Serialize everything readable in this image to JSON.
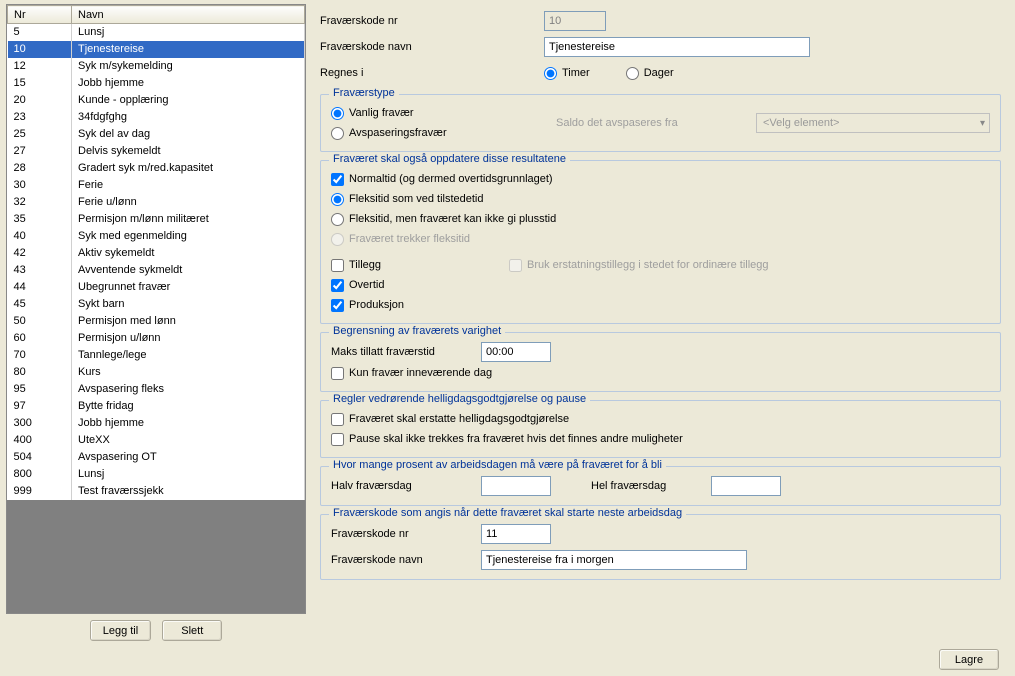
{
  "grid": {
    "headers": {
      "nr": "Nr",
      "navn": "Navn"
    },
    "rows": [
      {
        "nr": "5",
        "navn": "Lunsj"
      },
      {
        "nr": "10",
        "navn": "Tjenestereise",
        "selected": true
      },
      {
        "nr": "12",
        "navn": "Syk m/sykemelding"
      },
      {
        "nr": "15",
        "navn": "Jobb hjemme"
      },
      {
        "nr": "20",
        "navn": "Kunde - opplæring"
      },
      {
        "nr": "23",
        "navn": "34fdgfghg"
      },
      {
        "nr": "25",
        "navn": "Syk del av dag"
      },
      {
        "nr": "27",
        "navn": "Delvis sykemeldt"
      },
      {
        "nr": "28",
        "navn": "Gradert syk m/red.kapasitet"
      },
      {
        "nr": "30",
        "navn": "Ferie"
      },
      {
        "nr": "32",
        "navn": "Ferie u/lønn"
      },
      {
        "nr": "35",
        "navn": "Permisjon m/lønn militæret"
      },
      {
        "nr": "40",
        "navn": "Syk med egenmelding"
      },
      {
        "nr": "42",
        "navn": "Aktiv sykemeldt"
      },
      {
        "nr": "43",
        "navn": "Avventende sykmeldt"
      },
      {
        "nr": "44",
        "navn": "Ubegrunnet fravær"
      },
      {
        "nr": "45",
        "navn": "Sykt barn"
      },
      {
        "nr": "50",
        "navn": "Permisjon med lønn"
      },
      {
        "nr": "60",
        "navn": "Permisjon u/lønn"
      },
      {
        "nr": "70",
        "navn": "Tannlege/lege"
      },
      {
        "nr": "80",
        "navn": "Kurs"
      },
      {
        "nr": "95",
        "navn": "Avspasering fleks"
      },
      {
        "nr": "97",
        "navn": "Bytte fridag"
      },
      {
        "nr": "300",
        "navn": "Jobb hjemme"
      },
      {
        "nr": "400",
        "navn": "UteXX"
      },
      {
        "nr": "504",
        "navn": "Avspasering OT"
      },
      {
        "nr": "800",
        "navn": "Lunsj"
      },
      {
        "nr": "999",
        "navn": "Test fraværssjekk"
      }
    ]
  },
  "buttons": {
    "add": "Legg til",
    "delete": "Slett",
    "save": "Lagre"
  },
  "form": {
    "kode_nr_label": "Fraværskode nr",
    "kode_nr_value": "10",
    "kode_navn_label": "Fraværskode navn",
    "kode_navn_value": "Tjenestereise",
    "regnes_label": "Regnes i",
    "regnes_timer": "Timer",
    "regnes_dager": "Dager"
  },
  "type": {
    "legend": "Fraværstype",
    "vanlig": "Vanlig fravær",
    "avsp": "Avspaseringsfravær",
    "saldo_label": "Saldo det avspaseres fra",
    "saldo_placeholder": "<Velg element>"
  },
  "oppdater": {
    "legend": "Fraværet skal også oppdatere disse resultatene",
    "normaltid": "Normaltid (og dermed overtidsgrunnlaget)",
    "flex_tilstede": "Fleksitid som ved tilstedetid",
    "flex_ikkepluss": "Fleksitid, men fraværet kan ikke gi plusstid",
    "flex_trekker": "Fraværet trekker fleksitid",
    "tillegg": "Tillegg",
    "erstatning": "Bruk erstatningstillegg i stedet for ordinære tillegg",
    "overtid": "Overtid",
    "produksjon": "Produksjon"
  },
  "begrens": {
    "legend": "Begrensning av fraværets varighet",
    "maks_label": "Maks tillatt fraværstid",
    "maks_value": "00:00",
    "kun_dag": "Kun fravær inneværende dag"
  },
  "helligdag": {
    "legend": "Regler vedrørende helligdagsgodtgjørelse og pause",
    "erstatte": "Fraværet skal erstatte helligdagsgodtgjørelse",
    "pause": "Pause skal ikke trekkes fra fraværet hvis det finnes andre muligheter"
  },
  "prosent": {
    "legend": "Hvor mange prosent av arbeidsdagen må være på fraværet for å bli",
    "halv": "Halv fraværsdag",
    "halv_value": "",
    "hel": "Hel fraværsdag",
    "hel_value": ""
  },
  "neste": {
    "legend": "Fraværskode som angis når dette fraværet skal starte neste arbeidsdag",
    "nr_label": "Fraværskode nr",
    "nr_value": "11",
    "navn_label": "Fraværskode navn",
    "navn_value": "Tjenestereise fra i morgen"
  }
}
